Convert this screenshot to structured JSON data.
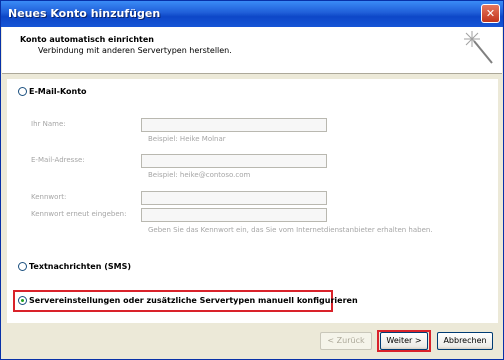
{
  "window": {
    "title": "Neues Konto hinzufügen",
    "close_glyph": "✕"
  },
  "header": {
    "title": "Konto automatisch einrichten",
    "subtitle": "Verbindung mit anderen Servertypen herstellen.",
    "icon": "wand-icon"
  },
  "options": {
    "email": {
      "label": "E-Mail-Konto",
      "selected": false
    },
    "sms": {
      "label": "Textnachrichten (SMS)",
      "selected": false
    },
    "manual": {
      "label": "Servereinstellungen oder zusätzliche Servertypen manuell konfigurieren",
      "selected": true
    }
  },
  "fields": {
    "name": {
      "label": "Ihr Name:",
      "value": "",
      "hint": "Beispiel: Heike Molnar"
    },
    "email": {
      "label": "E-Mail-Adresse:",
      "value": "",
      "hint": "Beispiel: heike@contoso.com"
    },
    "password": {
      "label": "Kennwort:",
      "value": ""
    },
    "password_repeat": {
      "label": "Kennwort erneut eingeben:",
      "value": ""
    },
    "password_hint": "Geben Sie das Kennwort ein, das Sie vom Internetdienstanbieter erhalten haben."
  },
  "buttons": {
    "back": "< Zurück",
    "next": "Weiter >",
    "cancel": "Abbrechen"
  },
  "colors": {
    "highlight": "#d9222a",
    "title_bar": "#0d47c8",
    "dialog_bg": "#ece9d8"
  }
}
